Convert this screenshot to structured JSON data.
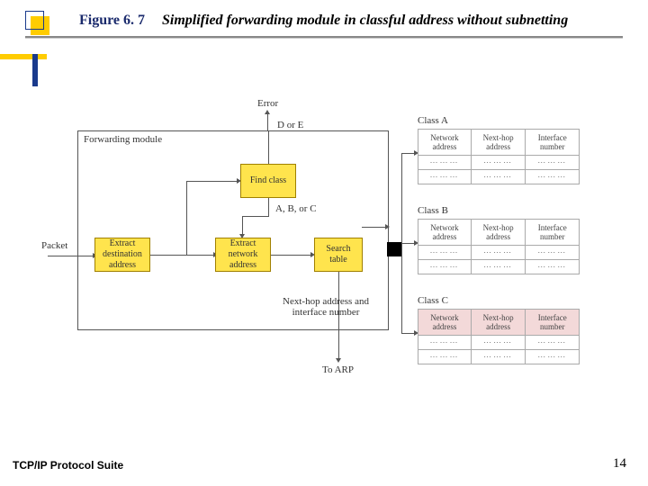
{
  "figure_number": "Figure 6. 7",
  "figure_title": "Simplified forwarding module in classful address without subnetting",
  "forwarding_module_label": "Forwarding module",
  "packet_label": "Packet",
  "boxes": {
    "extract_dest": "Extract destination address",
    "find_class": "Find class",
    "extract_net": "Extract network address",
    "search_table": "Search table"
  },
  "labels": {
    "error": "Error",
    "d_or_e": "D or E",
    "abc": "A, B, or C",
    "nexthop_if": "Next-hop address and interface number",
    "to_arp": "To ARP"
  },
  "class_tables": {
    "a_title": "Class A",
    "b_title": "Class B",
    "c_title": "Class C",
    "headers": {
      "col1": "Network address",
      "col2": "Next-hop address",
      "col3": "Interface number"
    },
    "dots": "⋯⋯⋯"
  },
  "footer_left": "TCP/IP Protocol Suite",
  "footer_right": "14"
}
